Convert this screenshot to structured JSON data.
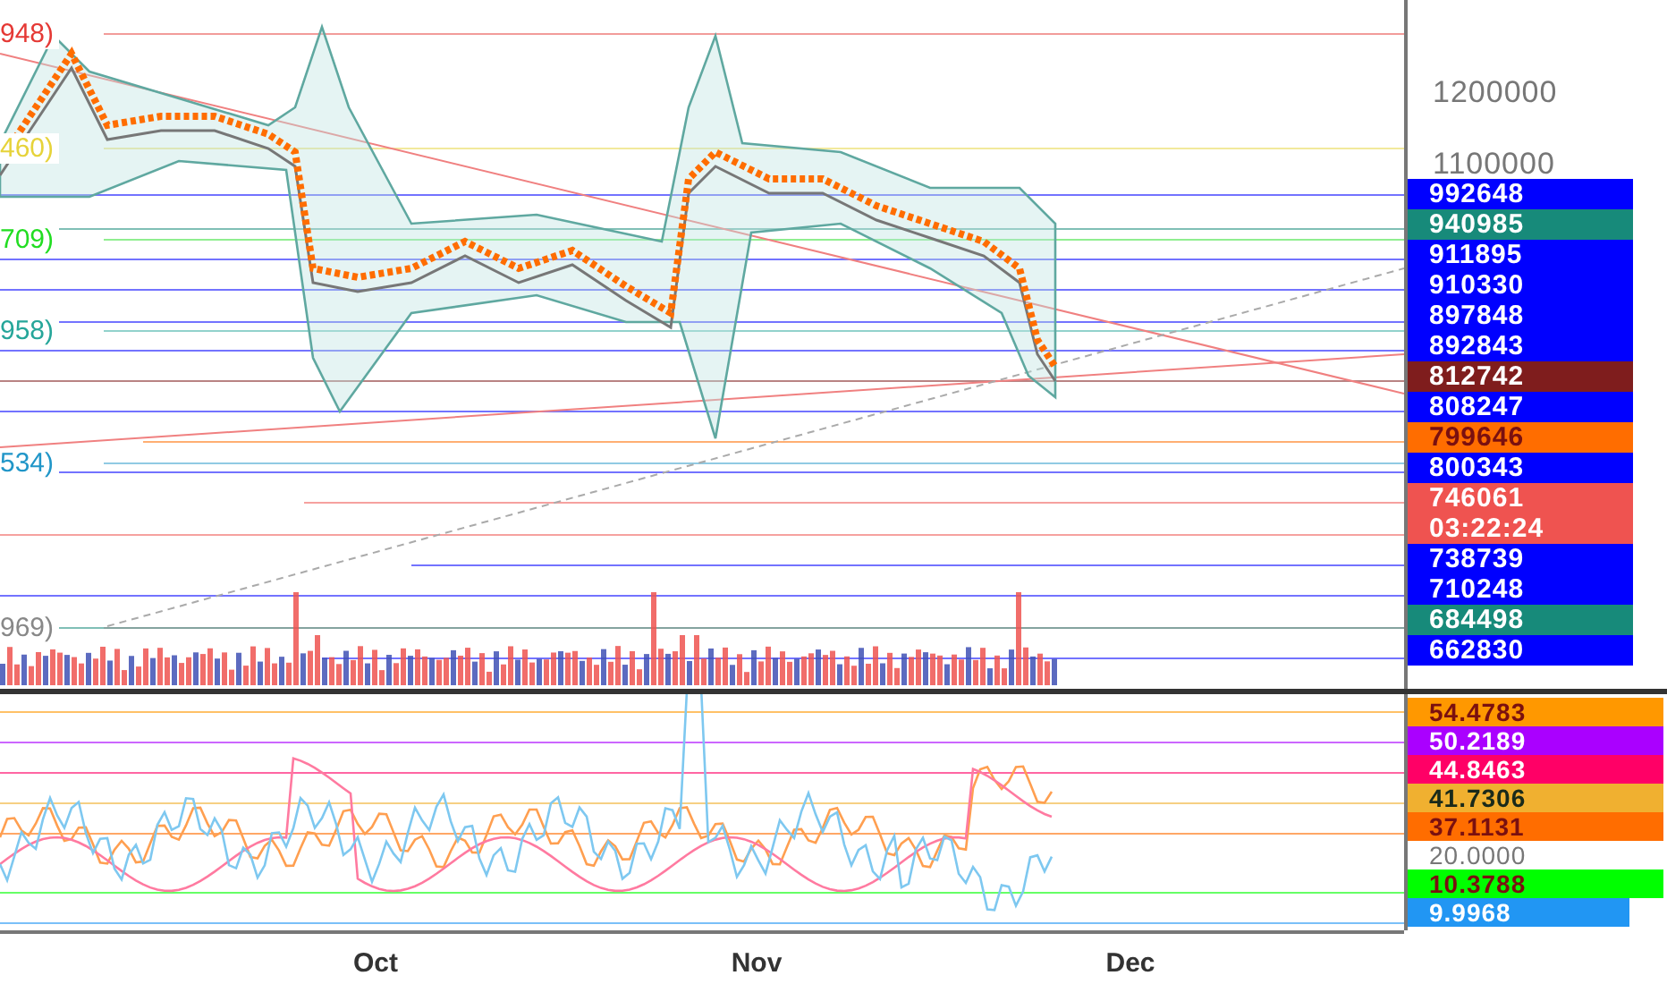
{
  "indicator_labels": [
    {
      "label": "948)",
      "color": "#e53935"
    },
    {
      "label": "460)",
      "color": "#e6d33a"
    },
    {
      "label": "709)",
      "color": "#22dd22"
    },
    {
      "label": "958)",
      "color": "#26a69a"
    },
    {
      "label": "534)",
      "color": "#2196c8"
    },
    {
      "label": "969)",
      "color": "#888888"
    }
  ],
  "price_axis": [
    {
      "kind": "tick",
      "label": "1200000"
    },
    {
      "kind": "tick",
      "label": "1100000"
    },
    {
      "kind": "tag",
      "label": "992648",
      "color": "#0000ff"
    },
    {
      "kind": "tag",
      "label": "940985",
      "color": "#178a7a"
    },
    {
      "kind": "tag",
      "label": "911895",
      "color": "#0000ff"
    },
    {
      "kind": "tag",
      "label": "910330",
      "color": "#0000ff"
    },
    {
      "kind": "tag",
      "label": "897848",
      "color": "#0000ff"
    },
    {
      "kind": "tag",
      "label": "892843",
      "color": "#0000ff"
    },
    {
      "kind": "tag",
      "label": "812742",
      "color": "#7f1d1d"
    },
    {
      "kind": "tag",
      "label": "808247",
      "color": "#0000ff"
    },
    {
      "kind": "tag",
      "label": "799646",
      "color": "#ff6d00"
    },
    {
      "kind": "tag",
      "label": "800343",
      "color": "#0000ff"
    },
    {
      "kind": "tag",
      "label": "746061",
      "color": "#ef5350"
    },
    {
      "kind": "tag",
      "label": "03:22:24",
      "color": "#ef5350"
    },
    {
      "kind": "tag",
      "label": "738739",
      "color": "#0000ff"
    },
    {
      "kind": "tag",
      "label": "710248",
      "color": "#0000ff"
    },
    {
      "kind": "tag",
      "label": "684498",
      "color": "#178a7a"
    },
    {
      "kind": "tag",
      "label": "662830",
      "color": "#0000ff"
    }
  ],
  "oscillator_axis": [
    {
      "kind": "tag",
      "label": "54.4783",
      "color": "#ff9800"
    },
    {
      "kind": "tag",
      "label": "50.2189",
      "color": "#aa00ff"
    },
    {
      "kind": "tag",
      "label": "44.8463",
      "color": "#ff0066"
    },
    {
      "kind": "tag",
      "label": "41.7306",
      "color": "#f0b030"
    },
    {
      "kind": "tag",
      "label": "37.1131",
      "color": "#ff6d00"
    },
    {
      "kind": "tick",
      "label": "20.0000"
    },
    {
      "kind": "tag",
      "label": "10.3788",
      "color": "#00ff00"
    },
    {
      "kind": "tag",
      "label": "9.9968",
      "color": "#2196f3"
    }
  ],
  "time_axis": [
    "Oct",
    "Nov",
    "Dec"
  ]
}
